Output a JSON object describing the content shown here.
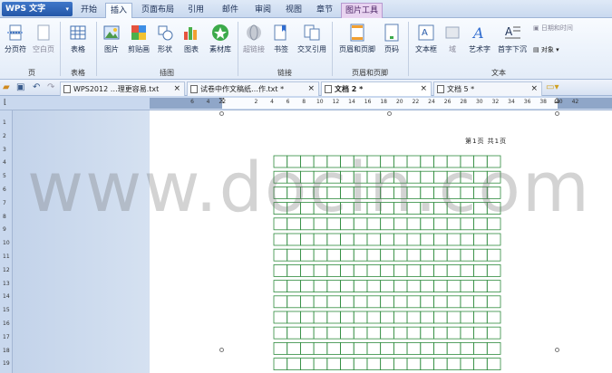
{
  "app": {
    "name": "WPS 文字",
    "menu_arrow": "▾"
  },
  "menu_tabs": [
    {
      "label": "开始"
    },
    {
      "label": "插入",
      "active": true
    },
    {
      "label": "页面布局"
    },
    {
      "label": "引用"
    },
    {
      "label": "邮件"
    },
    {
      "label": "审阅"
    },
    {
      "label": "视图"
    },
    {
      "label": "章节"
    },
    {
      "label": "图片工具",
      "contextual": true
    }
  ],
  "ribbon": {
    "buttons": [
      {
        "label": "分页符",
        "icon": "page-break-icon"
      },
      {
        "label": "空白页",
        "icon": "blank-page-icon"
      },
      {
        "label": "表格",
        "icon": "table-icon"
      },
      {
        "label": "图片",
        "icon": "picture-icon"
      },
      {
        "label": "剪贴画",
        "icon": "clipart-icon"
      },
      {
        "label": "形状",
        "icon": "shape-icon"
      },
      {
        "label": "图表",
        "icon": "chart-icon"
      },
      {
        "label": "素材库",
        "icon": "material-library-icon"
      },
      {
        "label": "超链接",
        "icon": "hyperlink-icon"
      },
      {
        "label": "书签",
        "icon": "bookmark-icon"
      },
      {
        "label": "交叉引用",
        "icon": "cross-reference-icon"
      },
      {
        "label": "页眉和页脚",
        "icon": "header-footer-icon"
      },
      {
        "label": "页码",
        "icon": "page-number-icon"
      },
      {
        "label": "文本框",
        "icon": "textbox-icon"
      },
      {
        "label": "域",
        "icon": "field-icon"
      },
      {
        "label": "艺术字",
        "icon": "wordart-icon"
      },
      {
        "label": "首字下沉",
        "icon": "drop-cap-icon"
      }
    ],
    "small": {
      "datetime": "日期和时间",
      "object": "对象 ▾"
    },
    "groups": [
      "页",
      "表格",
      "插图",
      "链接",
      "页眉和页脚",
      "文本"
    ]
  },
  "doc_tabs": [
    {
      "label": "WPS2012 …理更容易.txt",
      "close": "×"
    },
    {
      "label": "试卷中作文稿纸…作.txt *",
      "close": "×"
    },
    {
      "label": "文档 2 *",
      "close": "×",
      "active": true
    },
    {
      "label": "文档 5 *",
      "close": "×"
    }
  ],
  "ruler": {
    "h_ticks": [
      "6",
      "4",
      "2",
      "",
      "2",
      "4",
      "6",
      "8",
      "10",
      "12",
      "14",
      "16",
      "18",
      "20",
      "22",
      "24",
      "26",
      "28",
      "30",
      "32",
      "34",
      "36",
      "38",
      "40",
      "42"
    ],
    "v_ticks": [
      "1",
      "2",
      "3",
      "4",
      "5",
      "6",
      "7",
      "8",
      "9",
      "10",
      "11",
      "12",
      "13",
      "14",
      "15",
      "16",
      "17",
      "18",
      "19"
    ]
  },
  "document": {
    "header_text": "第1页 共1页",
    "grid": {
      "cols": 17,
      "rows": 14
    },
    "watermark": "www.docin.com"
  },
  "colors": {
    "accent": "#2457a8",
    "grid_line": "#2e8b3d",
    "ruler": "#c9d8ee"
  }
}
